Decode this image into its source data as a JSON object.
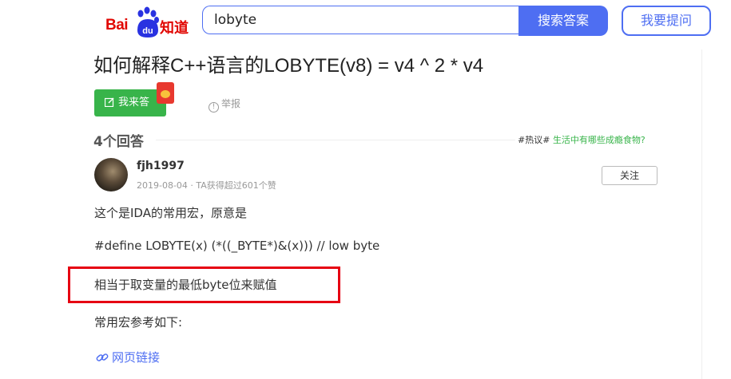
{
  "header": {
    "logo_bai": "Bai",
    "logo_du": "du",
    "logo_zhidao": "知道",
    "search_value": "lobyte",
    "search_button": "搜索答案",
    "ask_button": "我要提问"
  },
  "question": {
    "title": "如何解释C++语言的LOBYTE(v8) = v4 ^ 2 * v4",
    "answer_button": "我来答",
    "report": "举报"
  },
  "answers": {
    "count_label": "4个回答",
    "hot_prefix": "#热议#",
    "hot_topic": "生活中有哪些成瘾食物?"
  },
  "answer": {
    "username": "fjh1997",
    "meta": "2019-08-04 · TA获得超过601个赞",
    "follow": "关注",
    "line1": "这个是IDA的常用宏，原意是",
    "line2": "#define LOBYTE(x)   (*((_BYTE*)&(x)))   // low byte",
    "line3": "相当于取变量的最低byte位来赋值",
    "line4": "常用宏参考如下:",
    "link": "网页链接"
  },
  "colors": {
    "brand_blue": "#4e6ef2",
    "baidu_red": "#e10601",
    "green": "#38b44a",
    "highlight_red": "#e60012"
  }
}
